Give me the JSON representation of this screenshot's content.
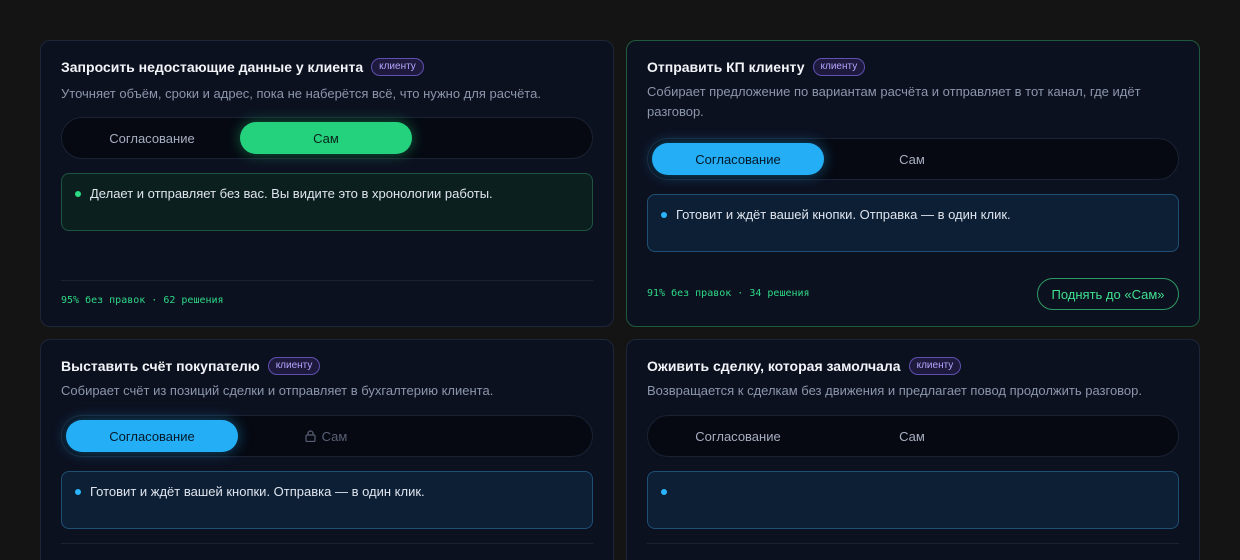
{
  "cards": [
    {
      "title": "Запросить недостающие данные у клиента",
      "badge": "клиенту",
      "description": "Уточняет объём, сроки и адрес, пока не наберётся всё, что нужно для расчёта.",
      "options": [
        "Согласование",
        "Сам"
      ],
      "selected": "Сам",
      "note": "Делает и отправляет без вас. Вы видите это в хронологии работы.",
      "stats": "95% без правок · 62 решения"
    },
    {
      "title": "Отправить КП клиенту",
      "badge": "клиенту",
      "description": "Собирает предложение по вариантам расчёта и отправляет в тот канал, где идёт разговор.",
      "options": [
        "Согласование",
        "Сам"
      ],
      "selected": "Согласование",
      "note": "Готовит и ждёт вашей кнопки. Отправка — в один клик.",
      "stats": "91% без правок · 34 решения",
      "action_label": "Поднять до «Сам»"
    },
    {
      "title": "Выставить счёт покупателю",
      "badge": "клиенту",
      "description": "Собирает счёт из позиций сделки и отправляет в бухгалтерию клиента.",
      "options": [
        "Согласование",
        "Сам"
      ],
      "selected": "Согласование",
      "locked_option": "Сам",
      "note": "Готовит и ждёт вашей кнопки. Отправка — в один клик."
    },
    {
      "title": "Оживить сделку, которая замолчала",
      "badge": "клиенту",
      "description": "Возвращается к сделкам без движения и предлагает повод продолжить разговор.",
      "options": [
        "Согласование",
        "Сам"
      ],
      "selected": "",
      "note": ""
    }
  ],
  "colors": {
    "background": "#141414",
    "card": "#0c1120",
    "active_green": "#24d17c",
    "active_blue": "#23aef5",
    "badge_purple": "#b6a4ff",
    "stats_green": "#2ed886"
  },
  "icons": {
    "locked_option": "lock-icon"
  }
}
